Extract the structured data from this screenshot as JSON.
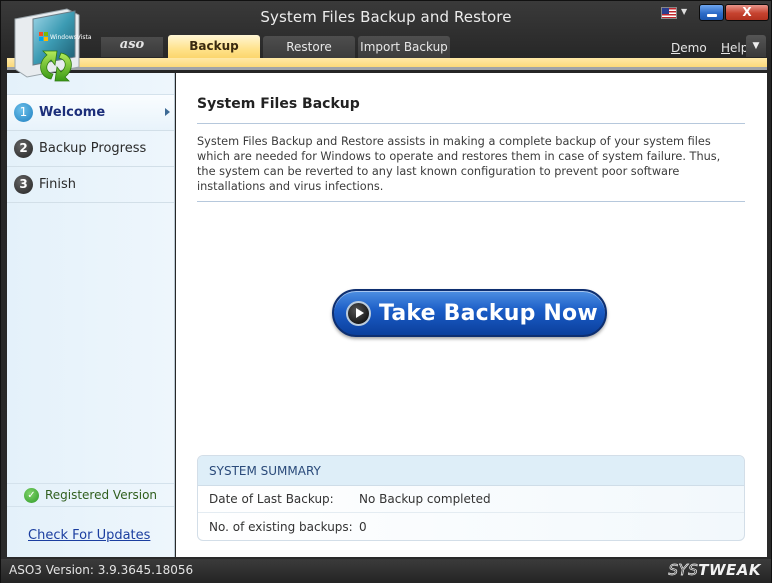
{
  "window": {
    "title": "System Files Backup and Restore",
    "close_glyph": "X"
  },
  "header": {
    "logo_alt": "System Files Backup and Restore logo",
    "brand_tab": "aso",
    "tabs": [
      {
        "label": "Backup",
        "active": true
      },
      {
        "label": "Restore",
        "active": false
      },
      {
        "label": "Import Backup",
        "active": false
      }
    ],
    "links": {
      "demo_first": "D",
      "demo_rest": "emo",
      "help_first": "H",
      "help_rest": "elp",
      "help_dropdown_glyph": "▼"
    },
    "language_flag": "us-flag-icon",
    "language_dropdown_glyph": "▼"
  },
  "sidebar": {
    "steps": [
      {
        "number": "1",
        "label": "Welcome",
        "active": true
      },
      {
        "number": "2",
        "label": "Backup Progress",
        "active": false
      },
      {
        "number": "3",
        "label": "Finish",
        "active": false
      }
    ],
    "registered_label": "Registered Version",
    "check_glyph": "✓",
    "updates_link": "Check For Updates"
  },
  "main": {
    "title": "System Files Backup",
    "description": "System Files Backup and Restore assists in making a complete backup of your system files which are needed for Windows to operate and restores them in case of system failure. Thus, the system can be reverted to any last known configuration to prevent poor software installations and virus infections.",
    "primary_button": "Take Backup Now",
    "summary": {
      "heading": "SYSTEM SUMMARY",
      "rows": [
        {
          "label": "Date of Last Backup:",
          "value": "No Backup completed"
        },
        {
          "label": "No. of existing backups:",
          "value": "0"
        }
      ]
    }
  },
  "statusbar": {
    "version": "ASO3 Version: 3.9.3645.18056",
    "brand_sys": "SYS",
    "brand_tweak": "TWEAK"
  }
}
